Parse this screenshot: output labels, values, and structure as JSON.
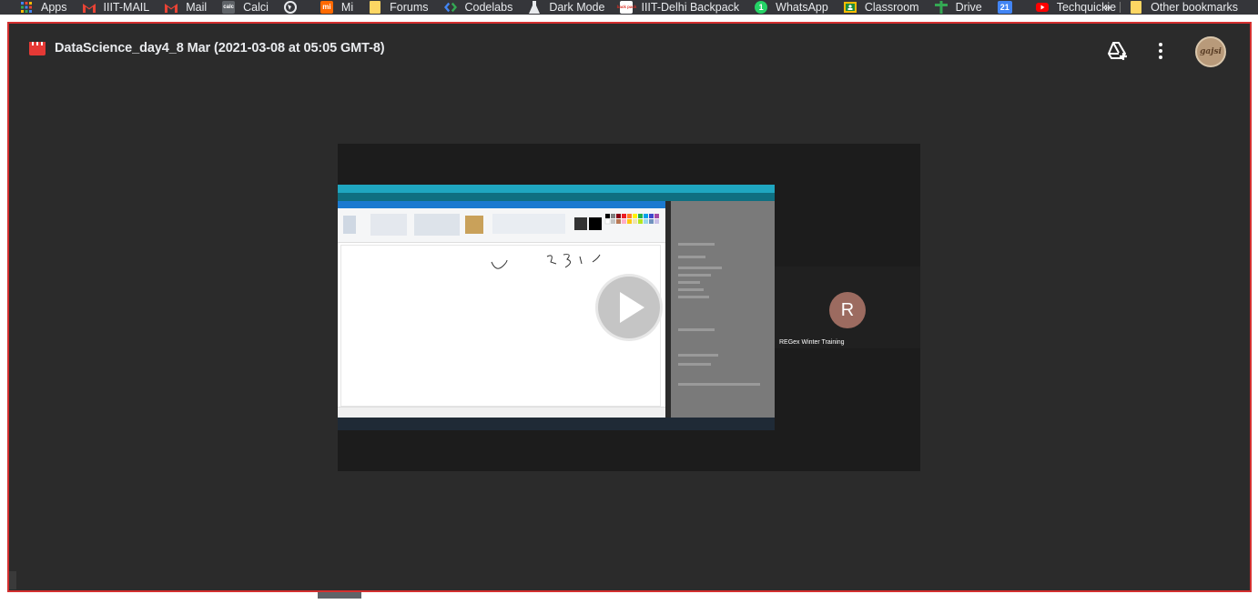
{
  "bookmarks": {
    "items": [
      {
        "label": "Apps",
        "icon": "apps-grid-icon",
        "color": "#4285f4"
      },
      {
        "label": "IIIT-MAIL",
        "icon": "gmail-icon",
        "color": "#ea4335"
      },
      {
        "label": "Mail",
        "icon": "gmail-icon",
        "color": "#ea4335"
      },
      {
        "label": "Calci",
        "icon": "calculator-icon",
        "color": "#9aa0a6"
      },
      {
        "label": "",
        "icon": "globe-icon",
        "color": "#e8eaed"
      },
      {
        "label": "Mi",
        "icon": "mi-icon",
        "color": "#ff6900"
      },
      {
        "label": "Forums",
        "icon": "folder-icon",
        "color": "#fdd663"
      },
      {
        "label": "Codelabs",
        "icon": "codelabs-icon",
        "color": "#4285f4"
      },
      {
        "label": "Dark Mode",
        "icon": "flask-icon",
        "color": "#e8eaed"
      },
      {
        "label": "IIIT-Delhi Backpack",
        "icon": "backpack-icon",
        "color": "#d93025"
      },
      {
        "label": "WhatsApp",
        "icon": "whatsapp-icon",
        "color": "#25d366"
      },
      {
        "label": "Classroom",
        "icon": "classroom-icon",
        "color": "#fbbc04"
      },
      {
        "label": "Drive",
        "icon": "drive-icon",
        "color": "#34a853"
      },
      {
        "label": "",
        "icon": "calendar-icon",
        "color": "#4285f4"
      },
      {
        "label": "Techquickie",
        "icon": "youtube-icon",
        "color": "#ff0000"
      }
    ],
    "overflow": "»",
    "other": "Other bookmarks",
    "calendar_day": "21",
    "calc_text": "calc",
    "mi_text": "mi",
    "whatsapp_badge": "1",
    "backpack_text": "back pack"
  },
  "viewer": {
    "title": "DataScience_day4_8 Mar (2021-03-08 at 05:05 GMT-8)",
    "avatar_text": "gajsi",
    "border_color": "#d32f2f"
  },
  "video": {
    "participant_initial": "R",
    "participant_name": "REGex Winter Training"
  }
}
